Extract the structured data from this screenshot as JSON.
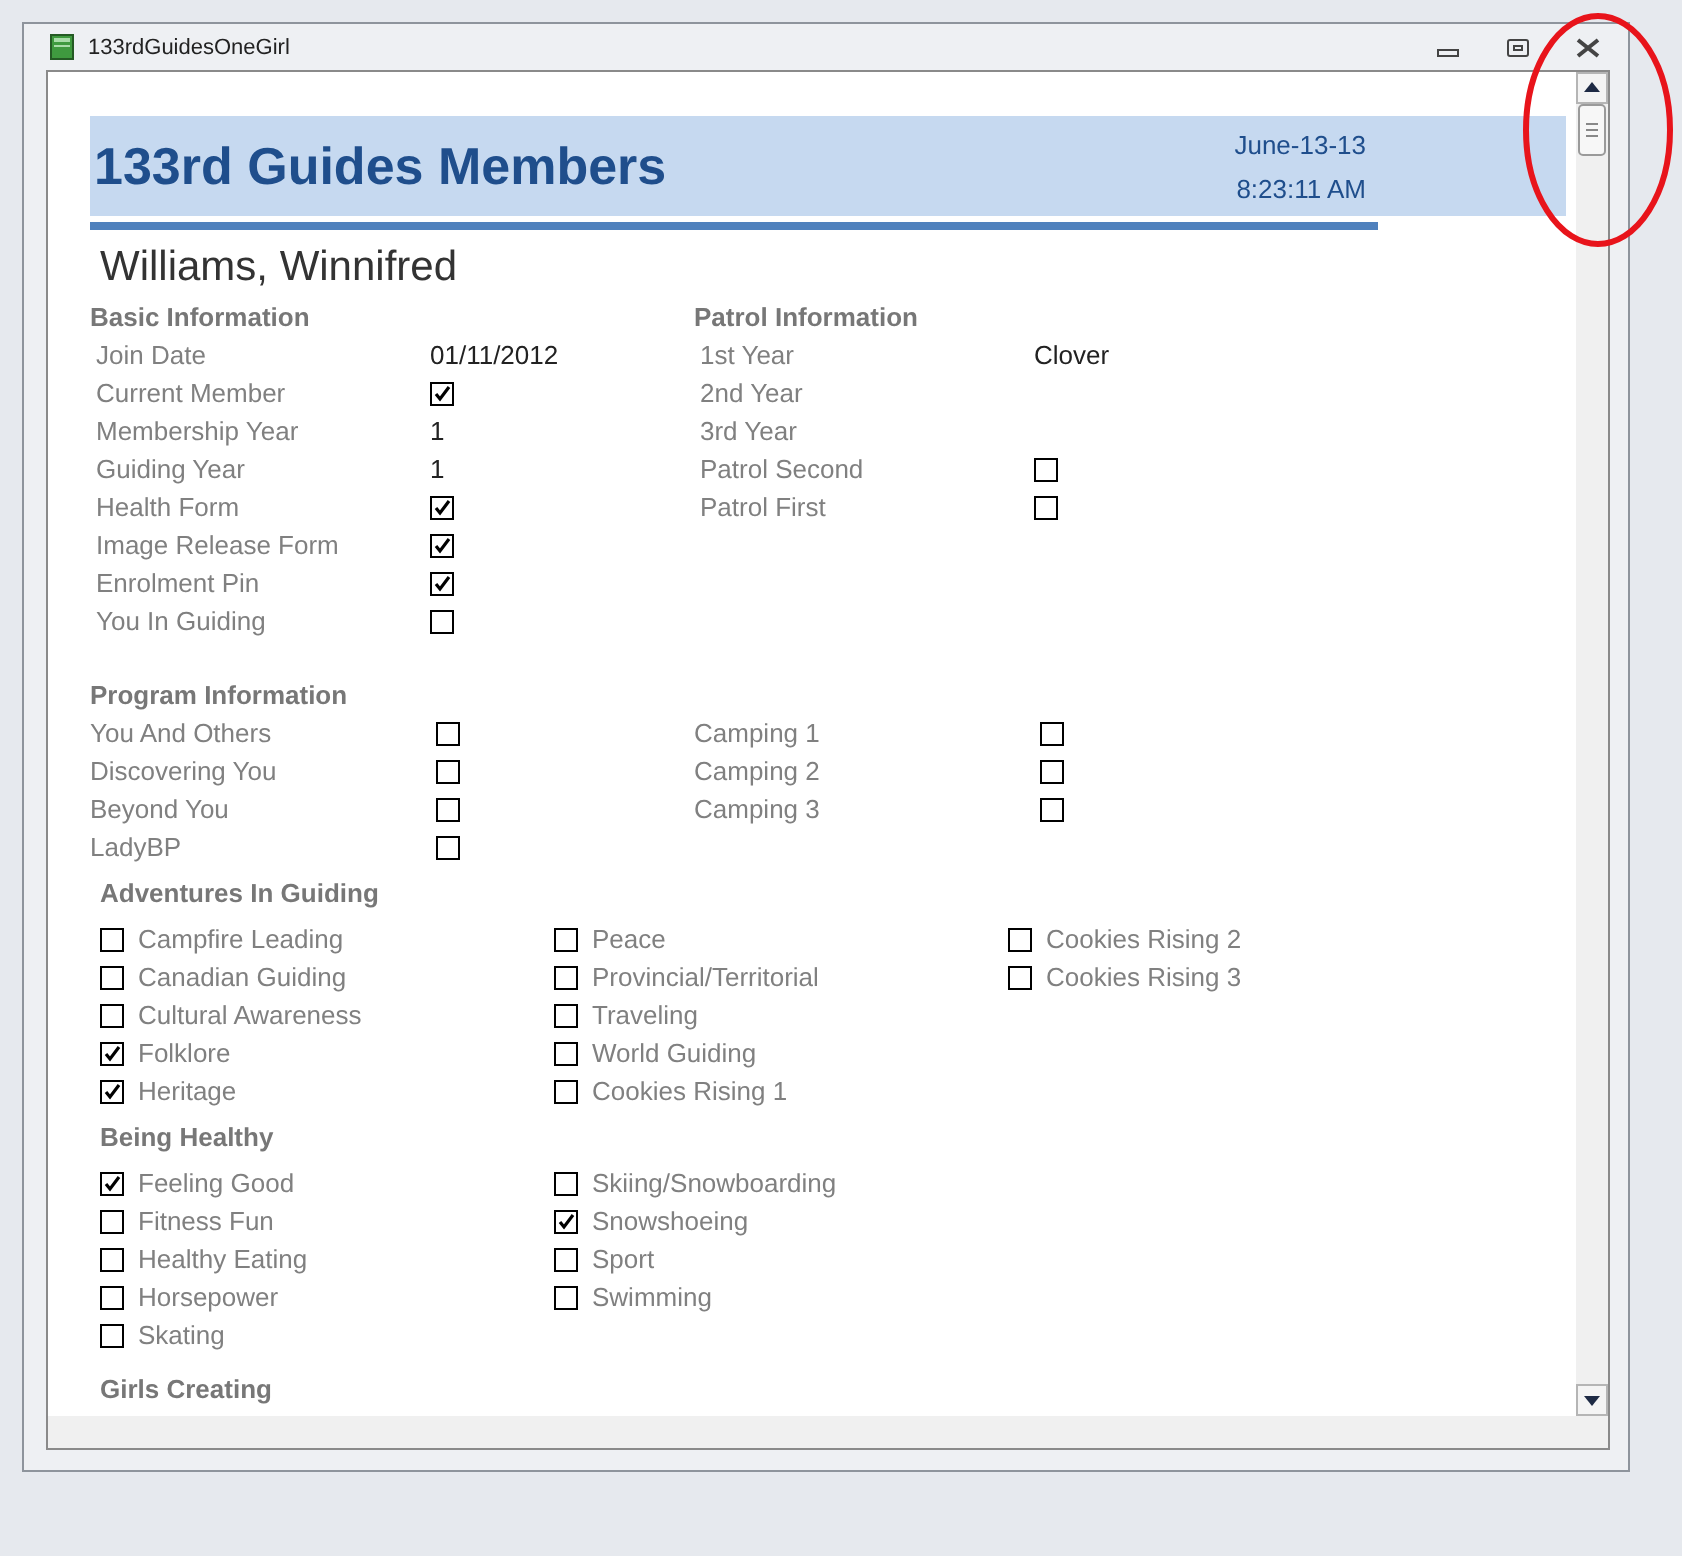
{
  "window": {
    "title": "133rdGuidesOneGirl"
  },
  "header": {
    "title": "133rd Guides Members",
    "date": "June-13-13",
    "time": "8:23:11 AM"
  },
  "member_name": "Williams, Winnifred",
  "info_blocks": [
    {
      "heading": "Basic Information",
      "fields": [
        {
          "label": "Join Date",
          "kind": "text",
          "value": "01/11/2012"
        },
        {
          "label": "Current Member",
          "kind": "checkbox",
          "checked": true
        },
        {
          "label": "Membership Year",
          "kind": "text",
          "value": "1"
        },
        {
          "label": "Guiding Year",
          "kind": "text",
          "value": "1"
        },
        {
          "label": "Health Form",
          "kind": "checkbox",
          "checked": true
        },
        {
          "label": "Image Release Form",
          "kind": "checkbox",
          "checked": true
        },
        {
          "label": "Enrolment Pin",
          "kind": "checkbox",
          "checked": true
        },
        {
          "label": "You In Guiding",
          "kind": "checkbox",
          "checked": false
        }
      ]
    },
    {
      "heading": "Patrol Information",
      "fields": [
        {
          "label": "1st Year",
          "kind": "text",
          "value": "Clover"
        },
        {
          "label": "2nd Year",
          "kind": "empty"
        },
        {
          "label": "3rd Year",
          "kind": "empty"
        },
        {
          "label": "Patrol Second",
          "kind": "checkbox",
          "checked": false
        },
        {
          "label": "Patrol First",
          "kind": "checkbox",
          "checked": false
        }
      ]
    }
  ],
  "program_information": {
    "heading": "Program Information",
    "columns": [
      [
        {
          "label": "You And Others",
          "checked": false
        },
        {
          "label": "Discovering You",
          "checked": false
        },
        {
          "label": "Beyond You",
          "checked": false
        },
        {
          "label": "LadyBP",
          "checked": false
        }
      ],
      [
        {
          "label": "Camping 1",
          "checked": false
        },
        {
          "label": "Camping 2",
          "checked": false
        },
        {
          "label": "Camping 3",
          "checked": false
        }
      ]
    ]
  },
  "checklists": [
    {
      "heading": "Adventures In Guiding",
      "columns": [
        [
          {
            "label": "Campfire Leading",
            "checked": false
          },
          {
            "label": "Canadian Guiding",
            "checked": false
          },
          {
            "label": "Cultural Awareness",
            "checked": false
          },
          {
            "label": "Folklore",
            "checked": true
          },
          {
            "label": "Heritage",
            "checked": true
          }
        ],
        [
          {
            "label": "Peace",
            "checked": false
          },
          {
            "label": "Provincial/Territorial",
            "checked": false
          },
          {
            "label": "Traveling",
            "checked": false
          },
          {
            "label": "World Guiding",
            "checked": false
          },
          {
            "label": "Cookies Rising 1",
            "checked": false
          }
        ],
        [
          {
            "label": "Cookies Rising 2",
            "checked": false
          },
          {
            "label": "Cookies Rising 3",
            "checked": false
          }
        ]
      ]
    },
    {
      "heading": "Being Healthy",
      "columns": [
        [
          {
            "label": "Feeling Good",
            "checked": true
          },
          {
            "label": "Fitness Fun",
            "checked": false
          },
          {
            "label": "Healthy Eating",
            "checked": false
          },
          {
            "label": "Horsepower",
            "checked": false
          },
          {
            "label": "Skating",
            "checked": false
          }
        ],
        [
          {
            "label": "Skiing/Snowboarding",
            "checked": false
          },
          {
            "label": "Snowshoeing",
            "checked": true
          },
          {
            "label": "Sport",
            "checked": false
          },
          {
            "label": "Swimming",
            "checked": false
          }
        ]
      ]
    },
    {
      "heading": "Girls Creating"
    }
  ]
}
